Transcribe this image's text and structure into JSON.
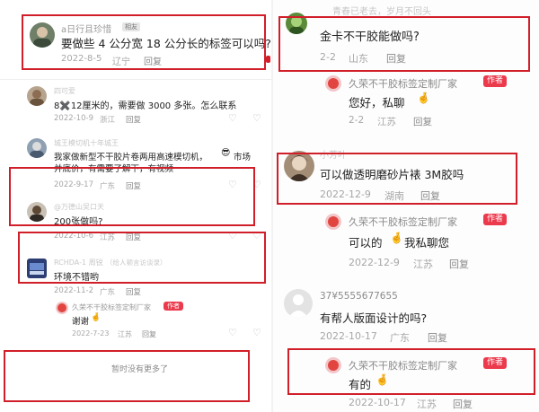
{
  "left": {
    "comments": [
      {
        "username": "a日行且珍惜",
        "badge": "相友",
        "text": "要做些 4 公分宽 18 公分长的标签可以吗?",
        "date": "2022-8-5",
        "location": "辽宁",
        "reply": "回复"
      },
      {
        "username": "四可爱",
        "text": "8✖️12厘米的，需要做 3000 多张。怎么联系",
        "date": "2022-10-9",
        "location": "浙江",
        "reply": "回复"
      },
      {
        "username": "城王模切机十年城王",
        "text_line1": "我家做新型不干胶片卷两用高速模切机，",
        "emoji": "😎",
        "text_line1_tail": "市场",
        "text_line2": "并底价，有需要了解下，有视频",
        "date": "2022-9-17",
        "location": "广东",
        "reply": "回复"
      },
      {
        "username": "@万德山吴口天",
        "text": "200张做吗?",
        "date": "2022-10-6",
        "location": "江苏",
        "reply": "回复"
      },
      {
        "username": "RCHDA-1 周锐",
        "username_tag": "（给人顿言访谈录）",
        "text": "环境不错哟",
        "date": "2022-11-2",
        "location": "广东",
        "reply": "回复"
      },
      {
        "username": "久荣不干胶标签定制厂家",
        "badge": "作者",
        "text": "谢谢",
        "emoji": "🤞",
        "date": "2022-7-23",
        "location": "江苏",
        "reply": "回复"
      }
    ],
    "end_text": "暂时没有更多了"
  },
  "right": {
    "top_faded_text": "青春已老去，岁月不回头",
    "comments": [
      {
        "text": "金卡不干胶能做吗?",
        "date": "2-2",
        "location": "山东",
        "reply": "回复"
      },
      {
        "username": "久荣不干胶标签定制厂家",
        "badge": "作者",
        "text": "您好，私聊",
        "emoji": "🤞",
        "date": "2-2",
        "location": "江苏",
        "reply": "回复"
      },
      {
        "username": "小芳叶",
        "text": "可以做透明磨砂片裱 3M胶吗",
        "date": "2022-12-9",
        "location": "湖南",
        "reply": "回复"
      },
      {
        "username": "久荣不干胶标签定制厂家",
        "badge": "作者",
        "text_pre": "可以的",
        "emoji": "🤞",
        "text_post": "我私聊您",
        "date": "2022-12-9",
        "location": "江苏",
        "reply": "回复"
      },
      {
        "username": "37¥5555677655",
        "text": "有帮人版面设计的吗?",
        "date": "2022-10-17",
        "location": "广东",
        "reply": "回复"
      },
      {
        "username": "久荣不干胶标签定制厂家",
        "badge": "作者",
        "text": "有的",
        "emoji": "🤞",
        "date": "2022-10-17",
        "location": "江苏",
        "reply": "回复"
      }
    ]
  },
  "icons": {
    "like": "heart-outline-icon",
    "dislike": "broken-heart-outline-icon"
  },
  "colors": {
    "highlight_box": "#d11f2a",
    "author_badge": "#ec3a4d",
    "muted_text": "#a7a7a7"
  }
}
